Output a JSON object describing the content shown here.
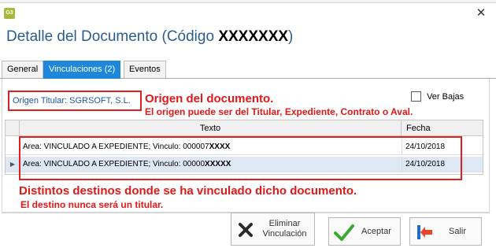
{
  "window": {
    "app_icon_label": "G3",
    "heading_prefix": "Detalle del Documento (Código",
    "heading_code": "XXXXXXX",
    "heading_suffix": ")",
    "close_symbol": "✕"
  },
  "tabs": [
    {
      "label": "General",
      "active": false
    },
    {
      "label": "Vinculaciones (2)",
      "active": true
    },
    {
      "label": "Eventos",
      "active": false
    }
  ],
  "origin": {
    "link_text": "Origen Titular: SGRSOFT, S.L."
  },
  "ver_bajas": {
    "label": "Ver Bajas",
    "checked": false
  },
  "grid": {
    "columns": {
      "texto": "Texto",
      "fecha": "Fecha"
    },
    "rows": [
      {
        "texto": "Area: VINCULADO A EXPEDIENTE; Vinculo: 000007",
        "mask": "XXXX",
        "fecha": "24/10/2018",
        "selected": false
      },
      {
        "texto": "Area: VINCULADO A EXPEDIENTE; Vinculo: 00000",
        "mask": "XXXXX",
        "fecha": "24/10/2018",
        "selected": true
      }
    ]
  },
  "annotations": {
    "origin_title": "Origen del documento.",
    "origin_note": "El origen puede ser del Titular, Expediente, Contrato o Aval.",
    "destinations_title": "Distintos destinos donde se ha vinculado dicho documento.",
    "destinations_note": "El destino nunca será un titular."
  },
  "buttons": {
    "eliminar_line1": "Eliminar",
    "eliminar_line2": "Vinculación",
    "aceptar": "Aceptar",
    "salir": "Salir"
  },
  "colors": {
    "accent": "#1e87d9",
    "heading": "#2b5d8c",
    "annotation_red": "#e01818",
    "selected_row": "#dde8f4",
    "link": "#2255aa"
  }
}
